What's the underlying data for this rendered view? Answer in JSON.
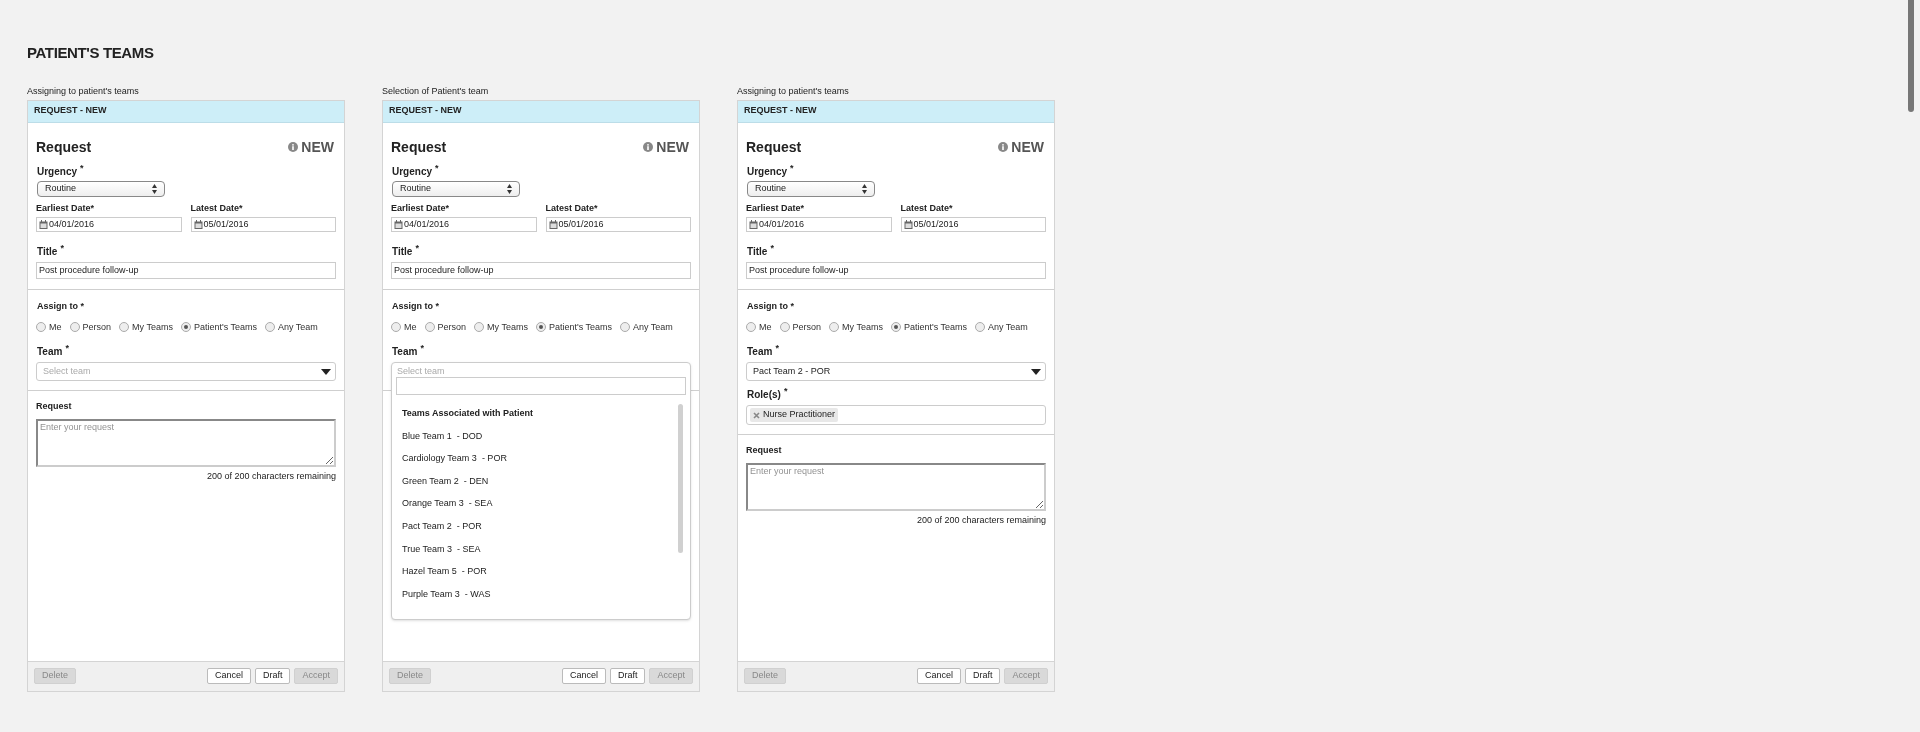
{
  "page_title": "PATIENT'S TEAMS",
  "panels": [
    {
      "caption": "Assigning to patient's teams",
      "header": "REQUEST - NEW",
      "heading": "Request",
      "badge": "NEW",
      "urgency": {
        "label": "Urgency",
        "required": "*",
        "value": "Routine"
      },
      "earliest": {
        "label": "Earliest Date*",
        "value": "04/01/2016"
      },
      "latest": {
        "label": "Latest Date*",
        "value": "05/01/2016"
      },
      "title_field": {
        "label": "Title",
        "required": "*",
        "value": "Post procedure follow-up"
      },
      "assign": {
        "label": "Assign to *",
        "options": [
          {
            "label": "Me",
            "selected": false
          },
          {
            "label": "Person",
            "selected": false
          },
          {
            "label": "My Teams",
            "selected": false
          },
          {
            "label": "Patient's Teams",
            "selected": true
          },
          {
            "label": "Any Team",
            "selected": false
          }
        ]
      },
      "team": {
        "label": "Team",
        "required": "*",
        "kind": "closed",
        "placeholder": "Select team"
      },
      "request": {
        "label": "Request",
        "placeholder": "Enter your request",
        "counter": "200 of 200 characters remaining"
      },
      "buttons": [
        {
          "label": "Delete",
          "disabled": true
        },
        {
          "label": "Cancel",
          "disabled": false
        },
        {
          "label": "Draft",
          "disabled": false
        },
        {
          "label": "Accept",
          "disabled": true
        }
      ]
    },
    {
      "caption": "Selection of Patient's team",
      "header": "REQUEST - NEW",
      "heading": "Request",
      "badge": "NEW",
      "urgency": {
        "label": "Urgency",
        "required": "*",
        "value": "Routine"
      },
      "earliest": {
        "label": "Earliest Date*",
        "value": "04/01/2016"
      },
      "latest": {
        "label": "Latest Date*",
        "value": "05/01/2016"
      },
      "title_field": {
        "label": "Title",
        "required": "*",
        "value": "Post procedure follow-up"
      },
      "assign": {
        "label": "Assign to *",
        "options": [
          {
            "label": "Me",
            "selected": false
          },
          {
            "label": "Person",
            "selected": false
          },
          {
            "label": "My Teams",
            "selected": false
          },
          {
            "label": "Patient's Teams",
            "selected": true
          },
          {
            "label": "Any Team",
            "selected": false
          }
        ]
      },
      "team": {
        "label": "Team",
        "required": "*",
        "kind": "open",
        "placeholder": "Select team",
        "group": "Teams Associated with Patient",
        "options": [
          "Blue Team 1  - DOD",
          "Cardiology Team 3  - POR",
          "Green Team 2  - DEN",
          "Orange Team 3  - SEA",
          "Pact Team 2  - POR",
          "True Team 3  - SEA",
          "Hazel Team 5  - POR",
          "Purple Team 3  - WAS"
        ]
      },
      "buttons": [
        {
          "label": "Delete",
          "disabled": true
        },
        {
          "label": "Cancel",
          "disabled": false
        },
        {
          "label": "Draft",
          "disabled": false
        },
        {
          "label": "Accept",
          "disabled": true
        }
      ]
    },
    {
      "caption": "Assigning to patient's teams",
      "header": "REQUEST - NEW",
      "heading": "Request",
      "badge": "NEW",
      "urgency": {
        "label": "Urgency",
        "required": "*",
        "value": "Routine"
      },
      "earliest": {
        "label": "Earliest Date*",
        "value": "04/01/2016"
      },
      "latest": {
        "label": "Latest Date*",
        "value": "05/01/2016"
      },
      "title_field": {
        "label": "Title",
        "required": "*",
        "value": "Post procedure follow-up"
      },
      "assign": {
        "label": "Assign to *",
        "options": [
          {
            "label": "Me",
            "selected": false
          },
          {
            "label": "Person",
            "selected": false
          },
          {
            "label": "My Teams",
            "selected": false
          },
          {
            "label": "Patient's Teams",
            "selected": true
          },
          {
            "label": "Any Team",
            "selected": false
          }
        ]
      },
      "team": {
        "label": "Team",
        "required": "*",
        "kind": "value",
        "value": "Pact Team 2 - POR"
      },
      "roles": {
        "label": "Role(s)",
        "required": "*",
        "tags": [
          "Nurse Practitioner"
        ]
      },
      "request": {
        "label": "Request",
        "placeholder": "Enter your request",
        "counter": "200 of 200 characters remaining"
      },
      "buttons": [
        {
          "label": "Delete",
          "disabled": true
        },
        {
          "label": "Cancel",
          "disabled": false
        },
        {
          "label": "Draft",
          "disabled": false
        },
        {
          "label": "Accept",
          "disabled": true
        }
      ]
    }
  ]
}
